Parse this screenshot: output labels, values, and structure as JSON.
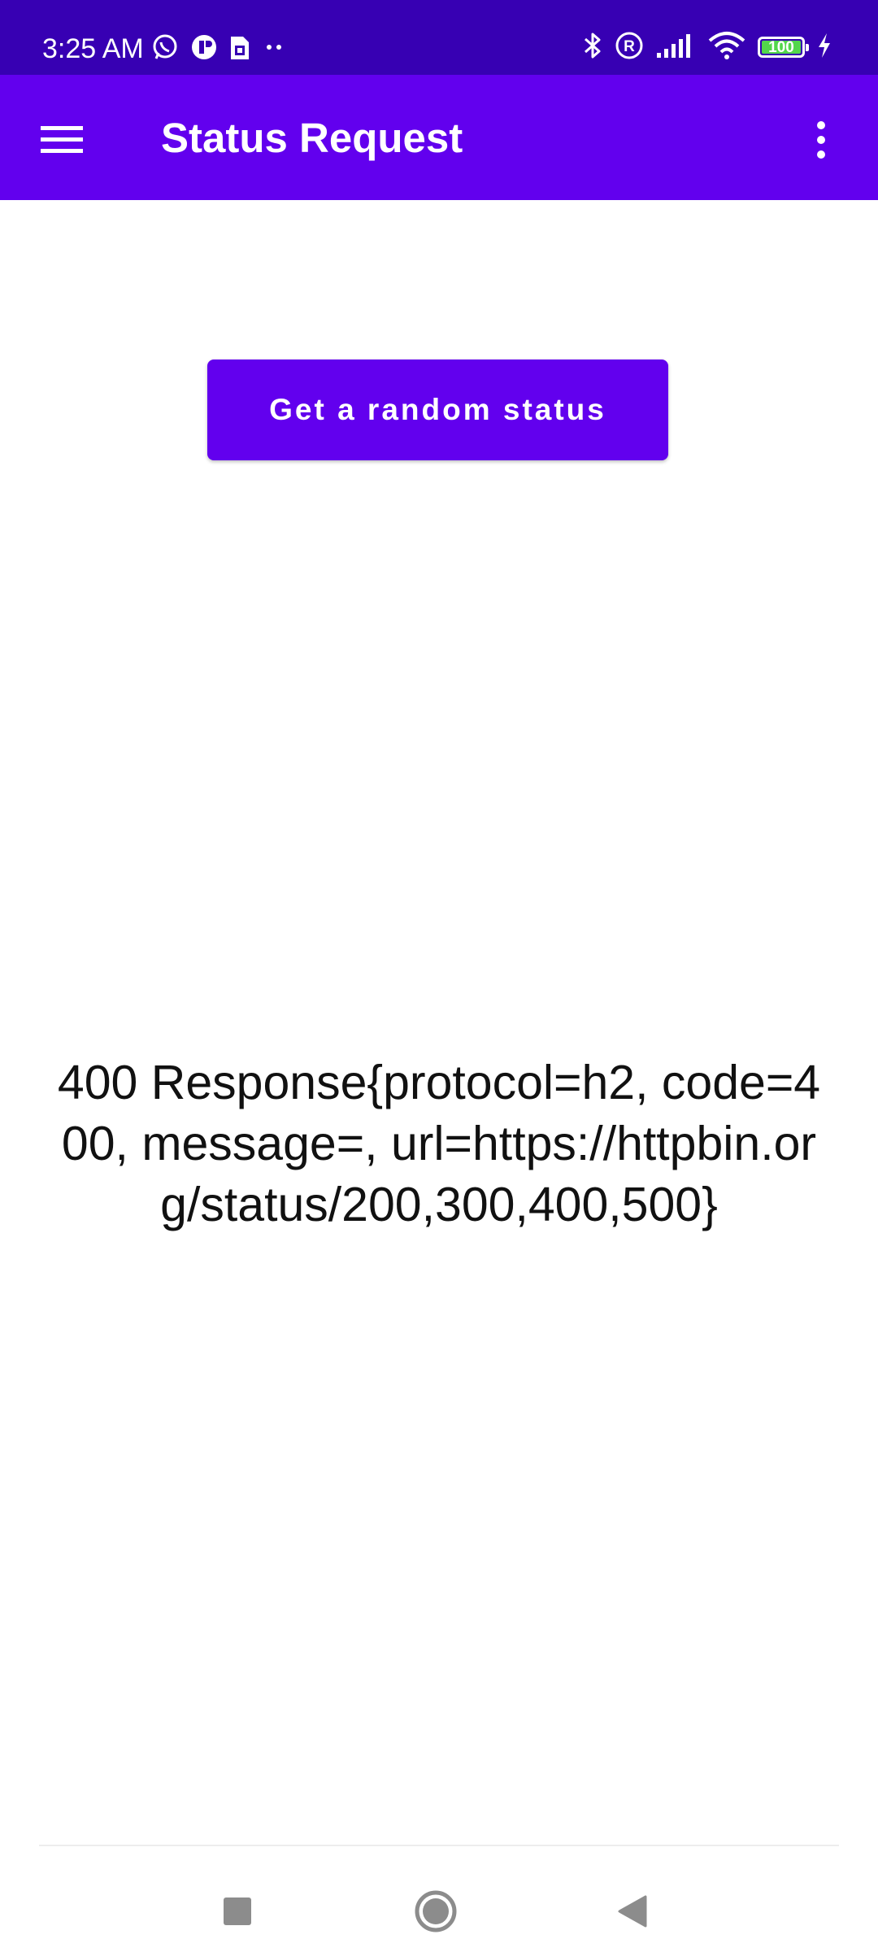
{
  "status_bar": {
    "time": "3:25 AM",
    "notification_icons": [
      "whatsapp-icon",
      "app-notification-icon",
      "sim-icon",
      "more-notifications-icon"
    ],
    "system_icons": [
      "bluetooth-icon",
      "roaming-icon",
      "signal-icon",
      "wifi-icon",
      "battery-icon",
      "charging-icon"
    ],
    "battery_level": "100"
  },
  "app_bar": {
    "title": "Status Request",
    "menu_icon": "hamburger-menu-icon",
    "overflow_icon": "more-vert-icon",
    "color": "#6200ee"
  },
  "main": {
    "button_label": "Get a random status",
    "response_text": "400 Response{protocol=h2, code=400, message=, url=https://httpbin.org/status/200,300,400,500}"
  },
  "nav_bar": {
    "buttons": [
      "recents-square-icon",
      "home-circle-icon",
      "back-triangle-icon"
    ]
  },
  "colors": {
    "status_bar": "#3700b3",
    "primary": "#6200ee",
    "battery_fill": "#53d64b"
  }
}
